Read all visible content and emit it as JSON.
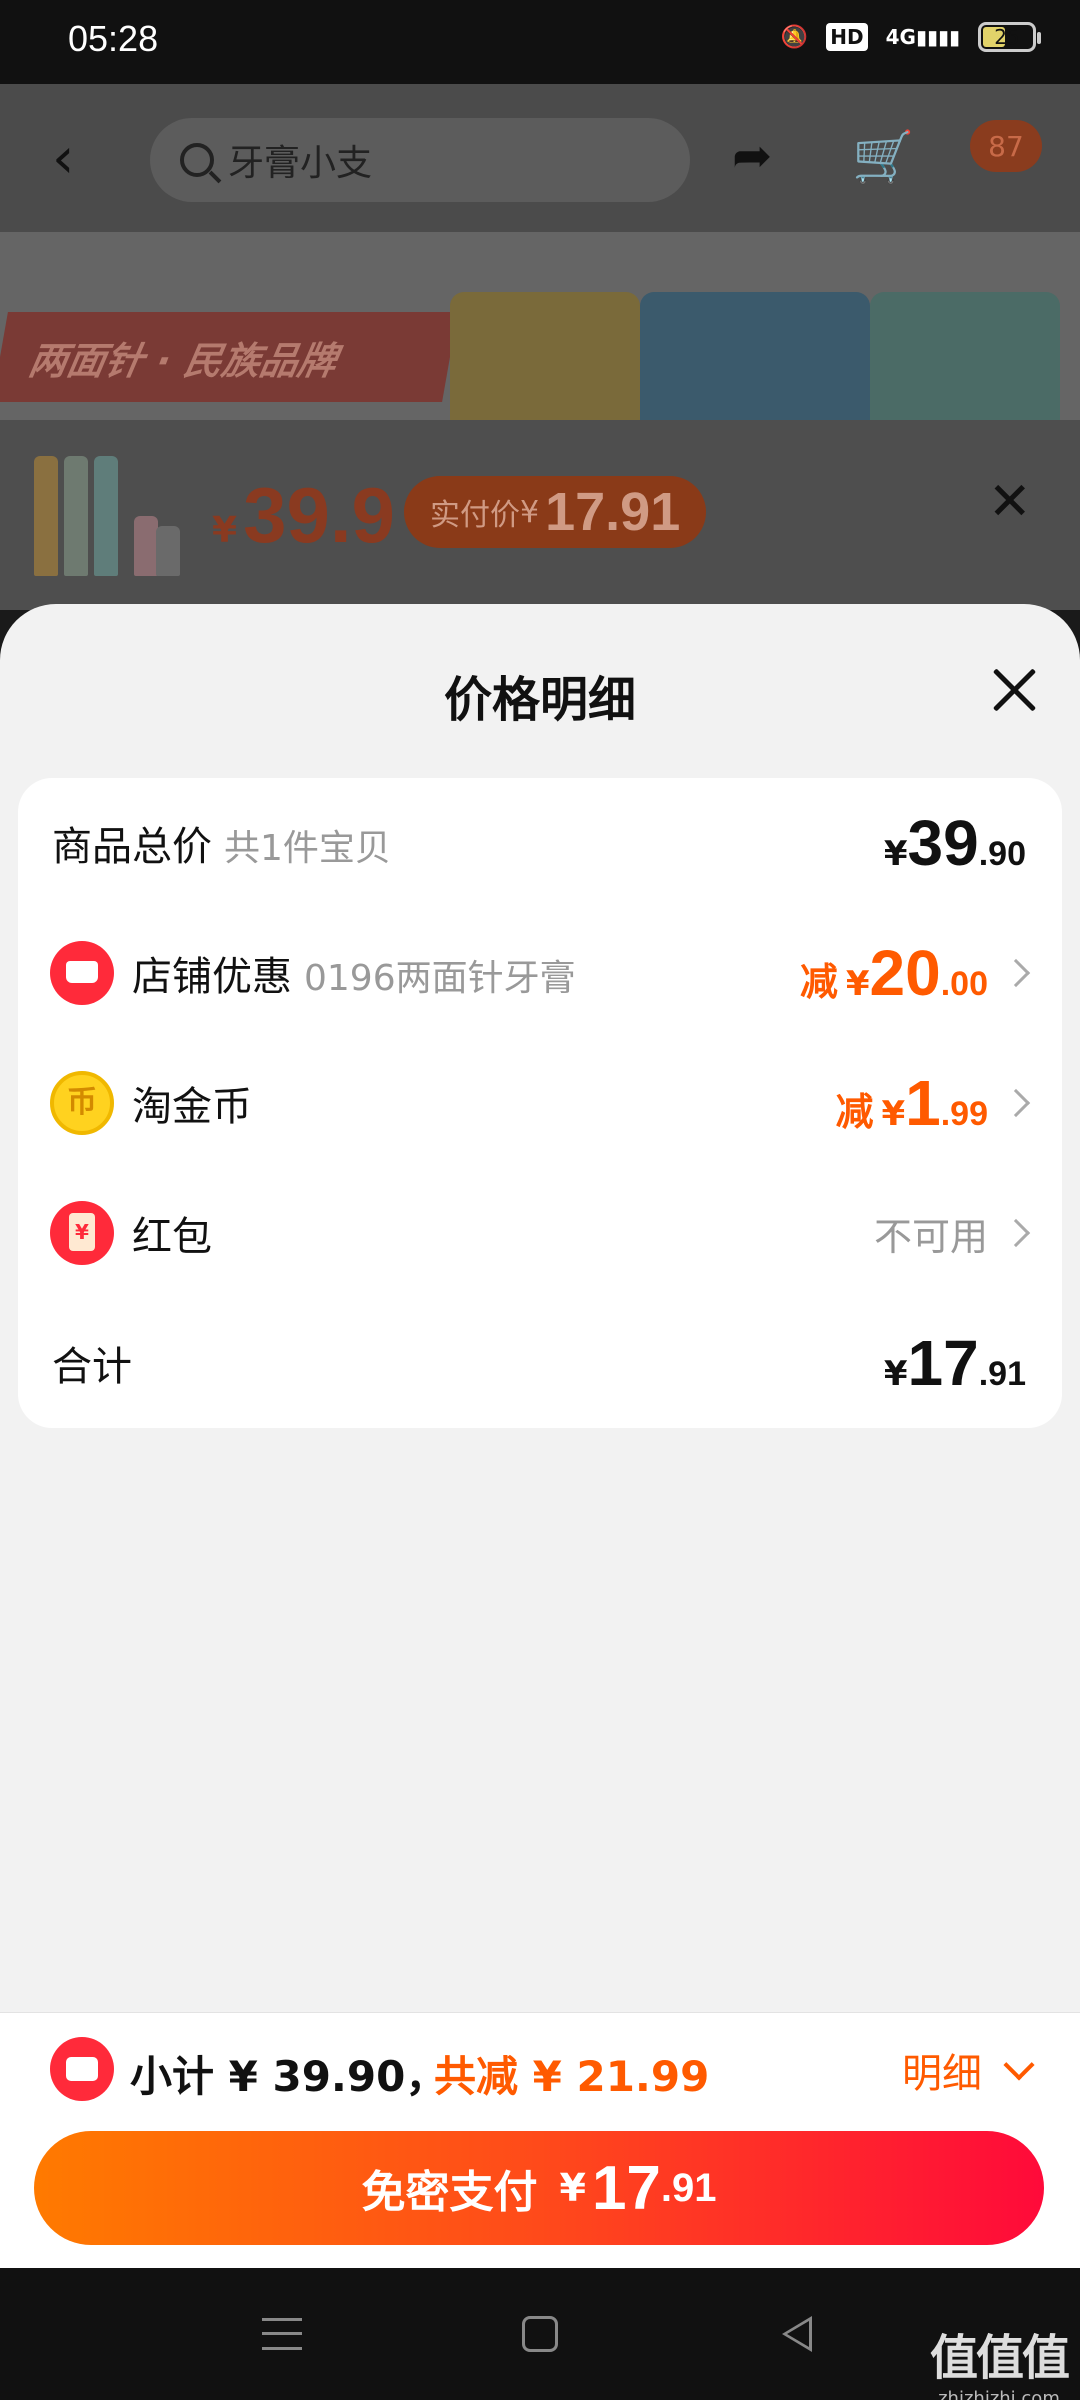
{
  "status_bar": {
    "time": "05:28",
    "hd": "HD",
    "network": "4G",
    "battery": "25"
  },
  "top_bar": {
    "search_placeholder": "牙膏小支",
    "message_badge": "87"
  },
  "banner": {
    "brand_text": "两面针 · 民族品牌"
  },
  "product_strip": {
    "currency": "¥",
    "price": "39.9",
    "real_price_label": "实付价",
    "real_price_currency": "¥",
    "real_price": "17.91"
  },
  "sheet": {
    "title": "价格明细",
    "rows": {
      "total": {
        "label": "商品总价",
        "sub": "共1件宝贝",
        "currency": "¥",
        "int": "39",
        "dec": ".90"
      },
      "store_discount": {
        "label": "店铺优惠",
        "sub": "0196两面针牙膏",
        "prefix": "减",
        "currency": "¥",
        "int": "20",
        "dec": ".00"
      },
      "gold_coin": {
        "label": "淘金币",
        "prefix": "减",
        "currency": "¥",
        "int": "1",
        "dec": ".99"
      },
      "red_packet": {
        "label": "红包",
        "status": "不可用"
      },
      "sum": {
        "label": "合计",
        "currency": "¥",
        "int": "17",
        "dec": ".91"
      }
    }
  },
  "footer": {
    "subtotal": "小计 ¥ 39.90，",
    "saved": "共减 ¥ 21.99",
    "detail": "明细",
    "pay_label": "免密支付",
    "pay_currency": "¥",
    "pay_int": "17",
    "pay_dec": ".91"
  },
  "watermark": {
    "main": "值值值",
    "sub": "zhizhizhi.com"
  },
  "colors": {
    "accent_orange": "#ff5a00",
    "accent_red": "#ff2a3a",
    "sheet_bg": "#f2f2f2"
  }
}
